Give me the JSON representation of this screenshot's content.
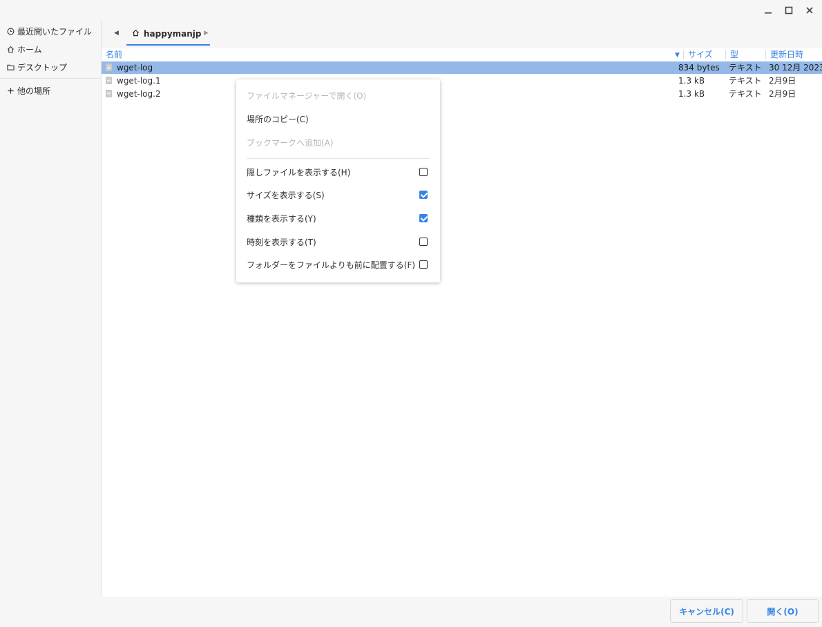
{
  "sidebar": {
    "items": [
      {
        "label": "最近開いたファイル",
        "icon": "clock-icon"
      },
      {
        "label": "ホーム",
        "icon": "home-icon"
      },
      {
        "label": "デスクトップ",
        "icon": "folder-icon"
      }
    ],
    "other_places": {
      "label": "他の場所",
      "icon": "plus-icon"
    }
  },
  "pathbar": {
    "current": "happymanjp"
  },
  "columns": {
    "name": "名前",
    "size": "サイズ",
    "type": "型",
    "modified": "更新日時"
  },
  "files": [
    {
      "name": "wget-log",
      "size": "834 bytes",
      "type": "テキスト",
      "modified": "30 12月 2023",
      "selected": true
    },
    {
      "name": "wget-log.1",
      "size": "1.3 kB",
      "type": "テキスト",
      "modified": "2月9日",
      "selected": false
    },
    {
      "name": "wget-log.2",
      "size": "1.3 kB",
      "type": "テキスト",
      "modified": "2月9日",
      "selected": false
    }
  ],
  "context_menu": {
    "open_file_manager": "ファイルマネージャーで開く(O)",
    "copy_location": "場所のコピー(C)",
    "add_bookmark": "ブックマークへ追加(A)",
    "show_hidden": {
      "label": "隠しファイルを表示する(H)",
      "checked": false
    },
    "show_size": {
      "label": "サイズを表示する(S)",
      "checked": true
    },
    "show_type": {
      "label": "種類を表示する(Y)",
      "checked": true
    },
    "show_time": {
      "label": "時刻を表示する(T)",
      "checked": false
    },
    "folders_first": {
      "label": "フォルダーをファイルよりも前に配置する(F)",
      "checked": false
    }
  },
  "buttons": {
    "cancel": "キャンセル(C)",
    "open": "開く(O)"
  },
  "colors": {
    "accent": "#3584e4",
    "selection": "#94b9e8"
  }
}
